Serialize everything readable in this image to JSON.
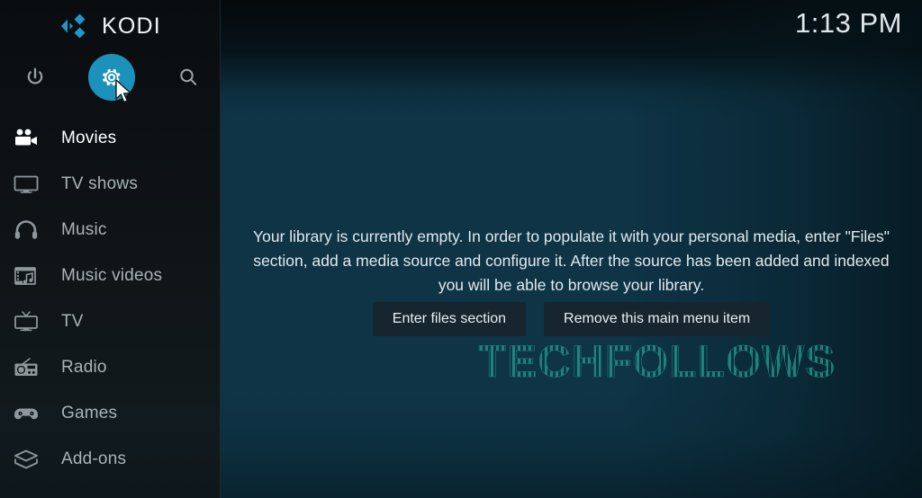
{
  "app": {
    "name": "KODI",
    "logo_icon": "kodi-logo-icon",
    "accent_color": "#1a92bb",
    "sidebar_bg": "#0d1114",
    "button_bg": "#17252e"
  },
  "header": {
    "clock": "1:13 PM",
    "icons": [
      {
        "name": "power-icon",
        "label": "Power"
      },
      {
        "name": "gear-icon",
        "label": "Settings",
        "selected": true
      },
      {
        "name": "search-icon",
        "label": "Search"
      }
    ]
  },
  "sidebar": {
    "items": [
      {
        "label": "Movies",
        "icon": "movie-camera-icon",
        "active": true
      },
      {
        "label": "TV shows",
        "icon": "television-icon",
        "active": false
      },
      {
        "label": "Music",
        "icon": "headphones-icon",
        "active": false
      },
      {
        "label": "Music videos",
        "icon": "film-note-icon",
        "active": false
      },
      {
        "label": "TV",
        "icon": "tv-antenna-icon",
        "active": false
      },
      {
        "label": "Radio",
        "icon": "radio-icon",
        "active": false
      },
      {
        "label": "Games",
        "icon": "gamepad-icon",
        "active": false
      },
      {
        "label": "Add-ons",
        "icon": "addon-box-icon",
        "active": false
      }
    ]
  },
  "main": {
    "empty_message": "Your library is currently empty. In order to populate it with your personal media, enter \"Files\" section, add a media source and configure it. After the source has been added and indexed you will be able to browse your library.",
    "buttons": [
      {
        "label": "Enter files section"
      },
      {
        "label": "Remove this main menu item"
      }
    ]
  },
  "watermark": {
    "text": "TECHFOLLOWS",
    "color": "#1f8f84"
  },
  "cursor": {
    "name": "mouse-pointer"
  }
}
